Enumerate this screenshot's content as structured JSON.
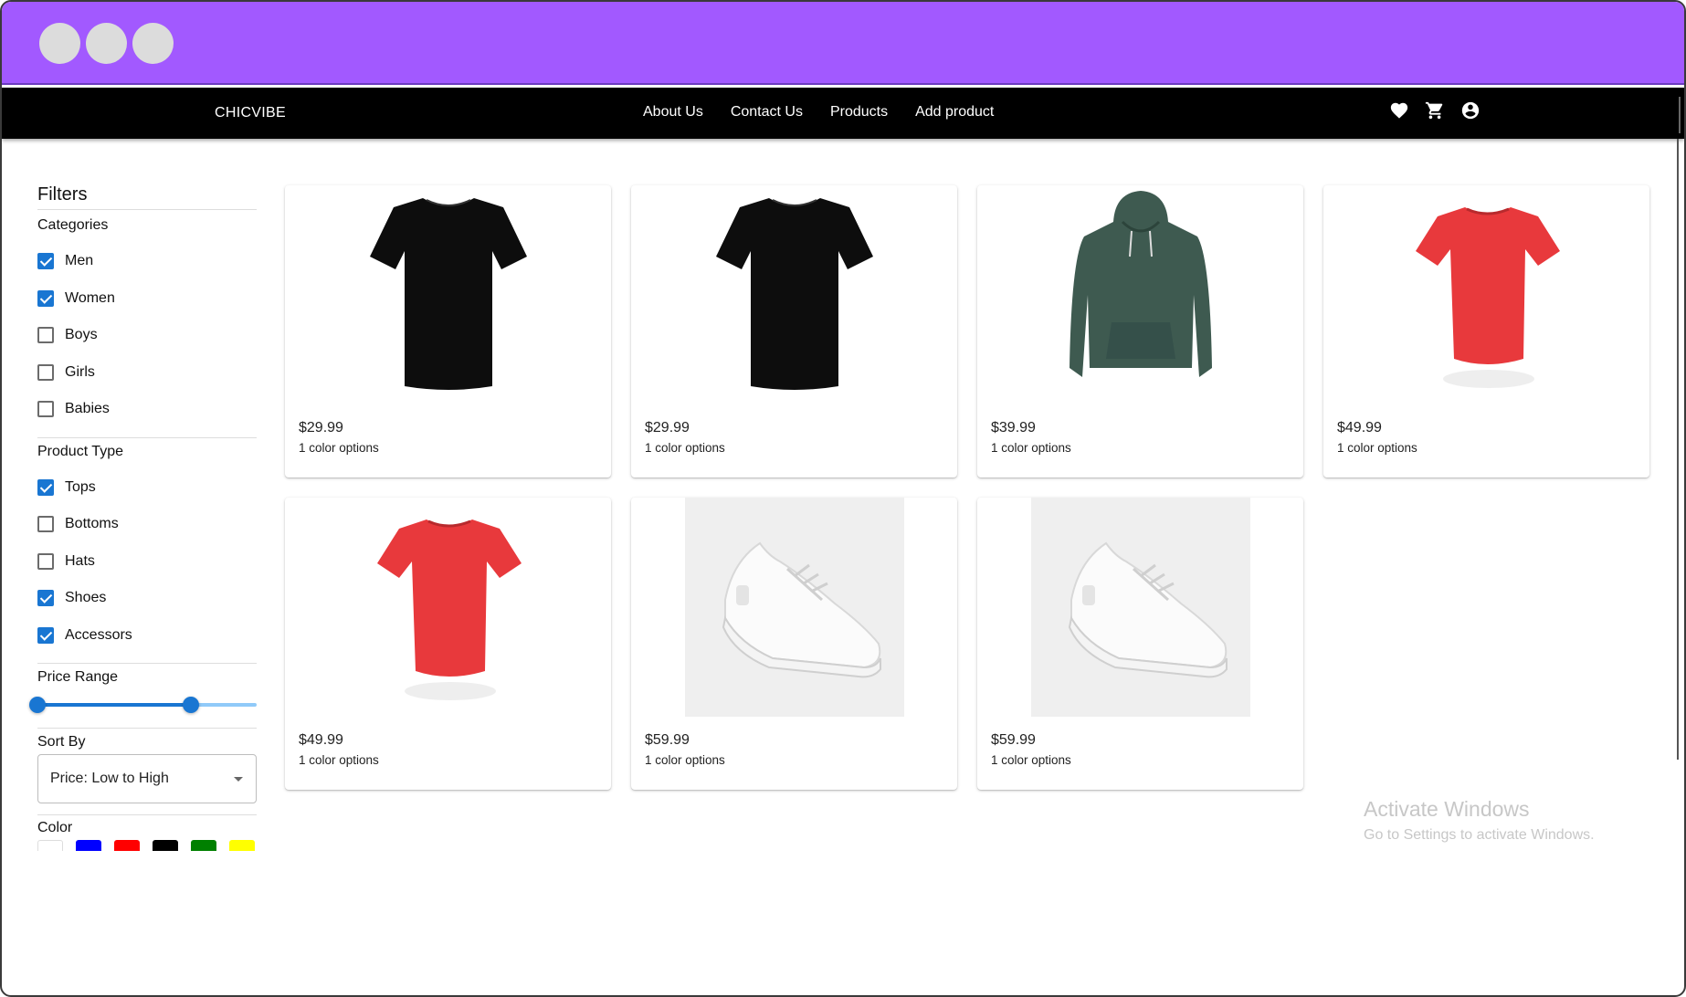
{
  "window": {
    "control_dots": 3
  },
  "nav": {
    "brand": "CHICVIBE",
    "links": [
      "About Us",
      "Contact Us",
      "Products",
      "Add product"
    ],
    "icons": [
      "heart-icon",
      "cart-icon",
      "account-icon"
    ]
  },
  "filters": {
    "title": "Filters",
    "categories_title": "Categories",
    "categories": [
      {
        "label": "Men",
        "checked": true
      },
      {
        "label": "Women",
        "checked": true
      },
      {
        "label": "Boys",
        "checked": false
      },
      {
        "label": "Girls",
        "checked": false
      },
      {
        "label": "Babies",
        "checked": false
      }
    ],
    "product_type_title": "Product Type",
    "product_types": [
      {
        "label": "Tops",
        "checked": true
      },
      {
        "label": "Bottoms",
        "checked": false
      },
      {
        "label": "Hats",
        "checked": false
      },
      {
        "label": "Shoes",
        "checked": true
      },
      {
        "label": "Accessors",
        "checked": true
      }
    ],
    "price_range_title": "Price Range",
    "price_range": {
      "low_fraction": 0.0,
      "high_fraction": 0.7
    },
    "sort_title": "Sort By",
    "sort_value": "Price: Low to High",
    "color_title": "Color",
    "colors": [
      "#ffffff",
      "#0000ff",
      "#ff0000",
      "#000000",
      "#008000",
      "#ffff00"
    ]
  },
  "products": [
    {
      "price": "$29.99",
      "options": "1 color options",
      "kind": "tshirt",
      "color": "#0d0d0d"
    },
    {
      "price": "$29.99",
      "options": "1 color options",
      "kind": "tshirt",
      "color": "#0d0d0d"
    },
    {
      "price": "$39.99",
      "options": "1 color options",
      "kind": "hoodie",
      "color": "#3e5a50"
    },
    {
      "price": "$49.99",
      "options": "1 color options",
      "kind": "womens-tee",
      "color": "#e8393c"
    },
    {
      "price": "$49.99",
      "options": "1 color options",
      "kind": "womens-tee",
      "color": "#e8393c"
    },
    {
      "price": "$59.99",
      "options": "1 color options",
      "kind": "sneaker",
      "color": "#f2f2f2"
    },
    {
      "price": "$59.99",
      "options": "1 color options",
      "kind": "sneaker",
      "color": "#f2f2f2"
    }
  ],
  "watermark": {
    "line1": "Activate Windows",
    "line2": "Go to Settings to activate Windows."
  }
}
